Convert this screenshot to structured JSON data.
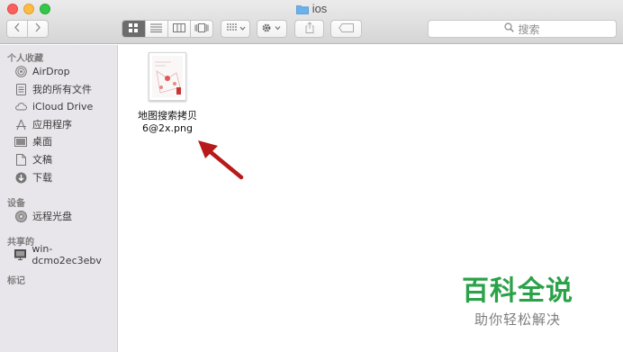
{
  "window": {
    "title": "ios",
    "search_placeholder": "搜索"
  },
  "sidebar": {
    "favorites_title": "个人收藏",
    "favorites": [
      {
        "label": "AirDrop",
        "icon": "airdrop-icon"
      },
      {
        "label": "我的所有文件",
        "icon": "all-files-icon"
      },
      {
        "label": "iCloud Drive",
        "icon": "cloud-icon"
      },
      {
        "label": "应用程序",
        "icon": "applications-icon"
      },
      {
        "label": "桌面",
        "icon": "desktop-icon"
      },
      {
        "label": "文稿",
        "icon": "documents-icon"
      },
      {
        "label": "下载",
        "icon": "download-icon"
      }
    ],
    "devices_title": "设备",
    "devices": [
      {
        "label": "远程光盘",
        "icon": "disc-icon"
      }
    ],
    "shared_title": "共享的",
    "shared": [
      {
        "label": "win-dcmo2ec3ebv",
        "icon": "pc-icon"
      }
    ],
    "tags_title": "标记"
  },
  "content": {
    "files": [
      {
        "name_line1": "地图搜索拷贝",
        "name_line2": "6@2x.png",
        "icon": "png-file-thumbnail"
      }
    ],
    "annotation": {
      "icon": "red-arrow-icon",
      "color": "#b81a1a"
    }
  },
  "watermark": {
    "title": "百科全说",
    "subtitle": "助你轻松解决"
  },
  "colors": {
    "sidebar_bg": "#e8e6ea",
    "active_view": "#6c6c6c",
    "watermark_green": "#2aa248"
  }
}
